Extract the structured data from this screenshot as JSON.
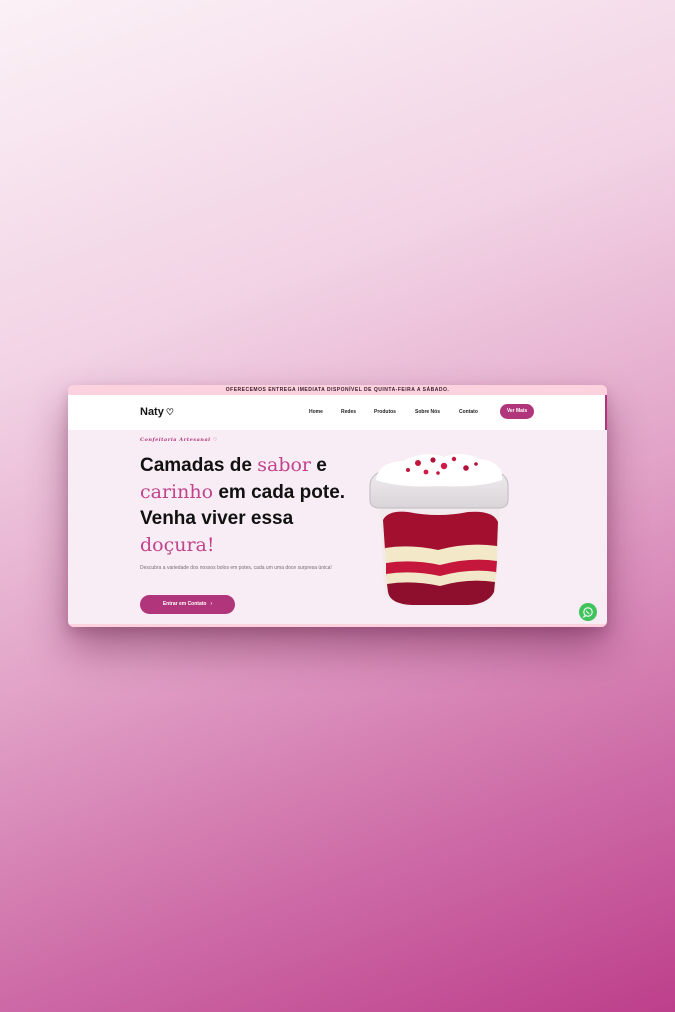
{
  "announcement": "OFERECEMOS ENTREGA IMEDIATA DISPONÍVEL DE QUINTA-FEIRA A SÁBADO.",
  "header": {
    "logo": "Naty",
    "logo_icon": "heart-outline-icon",
    "nav": [
      "Home",
      "Redes",
      "Produtos",
      "Sobre Nós",
      "Contato"
    ],
    "cta_label": "Ver Mais"
  },
  "hero": {
    "tagline": "Confeitaria Artesanal ♡",
    "headline": {
      "part1": "Camadas de ",
      "accent1": "sabor",
      "part2": " e ",
      "accent2": "carinho",
      "part3": " em cada pote. Venha viver essa ",
      "accent3": "doçura!"
    },
    "description": "Descubra a variedade dos nossos bolos em potes, cada um uma doce surpresa única!",
    "cta_label": "Entrar em Contato",
    "cta_icon": "chevron-right-icon",
    "image_alt": "red-velvet-cake-in-pot"
  },
  "floating": {
    "icon": "whatsapp-icon"
  },
  "colors": {
    "accent": "#b1357a",
    "headline_accent": "#c0438c",
    "announcement_bg": "#fbd2dd",
    "hero_bg": "#f8edf4",
    "whatsapp": "#3fc35a"
  }
}
